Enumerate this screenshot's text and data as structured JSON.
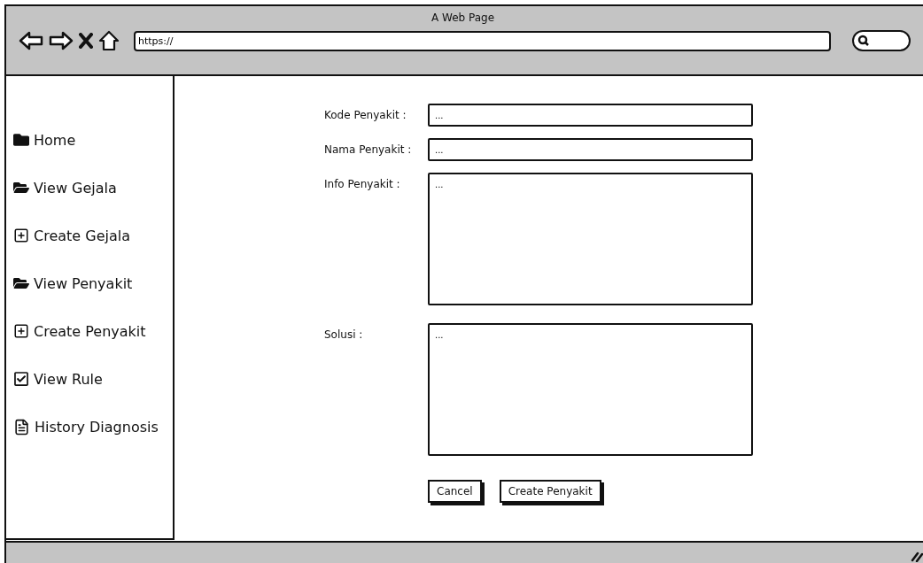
{
  "window": {
    "title": "A Web Page",
    "url": "https://"
  },
  "sidebar": {
    "items": [
      {
        "kind": "folder",
        "label": "Home"
      },
      {
        "kind": "folder-open",
        "label": "View Gejala"
      },
      {
        "kind": "plus",
        "label": "Create Gejala"
      },
      {
        "kind": "folder-open",
        "label": "View Penyakit"
      },
      {
        "kind": "plus",
        "label": "Create Penyakit"
      },
      {
        "kind": "check",
        "label": "View Rule"
      },
      {
        "kind": "document",
        "label": "History Diagnosis"
      }
    ]
  },
  "form": {
    "fields": [
      {
        "kind": "input",
        "label": "Kode Penyakit :",
        "value": "..."
      },
      {
        "kind": "input",
        "label": "Nama Penyakit :",
        "value": "..."
      },
      {
        "kind": "textarea",
        "label": "Info Penyakit :",
        "value": "..."
      },
      {
        "kind": "textarea",
        "label": "Solusi :",
        "value": "..."
      }
    ],
    "buttons": [
      "Cancel",
      "Create Penyakit"
    ]
  }
}
